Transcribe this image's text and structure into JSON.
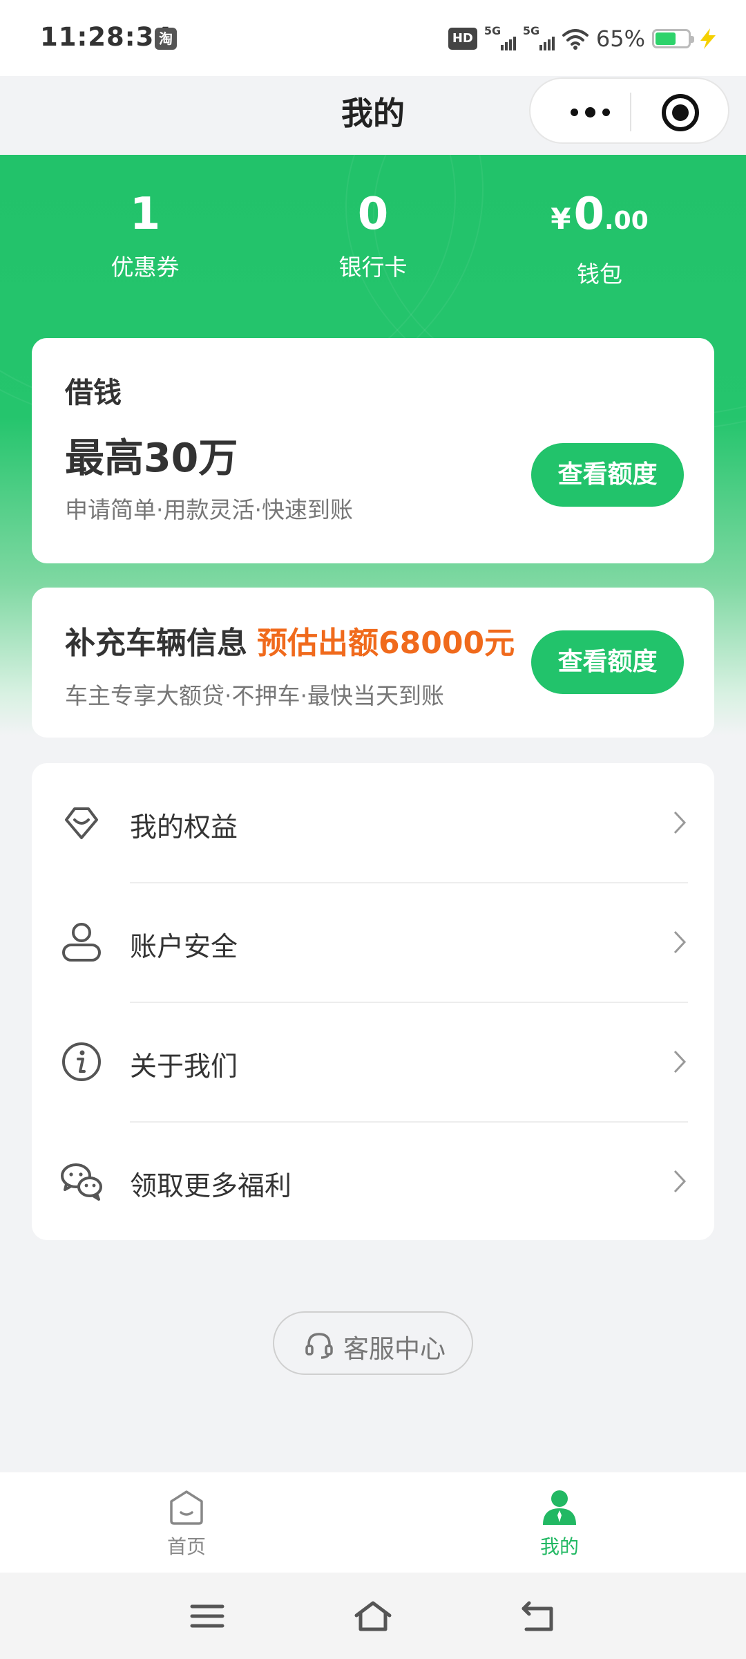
{
  "status_bar": {
    "time": "11:28:34",
    "app_badge": "淘",
    "hd_label": "HD",
    "signal1_label": "5G",
    "signal2_label": "5G",
    "battery_percent": "65%",
    "battery_level": 0.65
  },
  "nav": {
    "title": "我的"
  },
  "stats": [
    {
      "value": "1",
      "label": "优惠券"
    },
    {
      "value": "0",
      "label": "银行卡"
    },
    {
      "currency": "¥",
      "value": "0",
      "decimals": ".00",
      "label": "钱包"
    }
  ],
  "loan_card": {
    "title": "借钱",
    "amount": "最高30万",
    "description": "申请简单·用款灵活·快速到账",
    "button": "查看额度"
  },
  "vehicle_card": {
    "title": "补充车辆信息",
    "highlight": "预估出额68000元",
    "description": "车主专享大额贷·不押车·最快当天到账",
    "button": "查看额度"
  },
  "menu": [
    {
      "label": "我的权益",
      "icon": "benefits-icon"
    },
    {
      "label": "账户安全",
      "icon": "account-icon"
    },
    {
      "label": "关于我们",
      "icon": "info-icon"
    },
    {
      "label": "领取更多福利",
      "icon": "wechat-icon"
    }
  ],
  "service": {
    "label": "客服中心"
  },
  "tab_bar": [
    {
      "label": "首页",
      "icon": "home-icon",
      "active": false
    },
    {
      "label": "我的",
      "icon": "profile-icon",
      "active": true
    }
  ],
  "colors": {
    "brand_green": "#22c36b",
    "highlight_orange": "#f06a1c"
  }
}
